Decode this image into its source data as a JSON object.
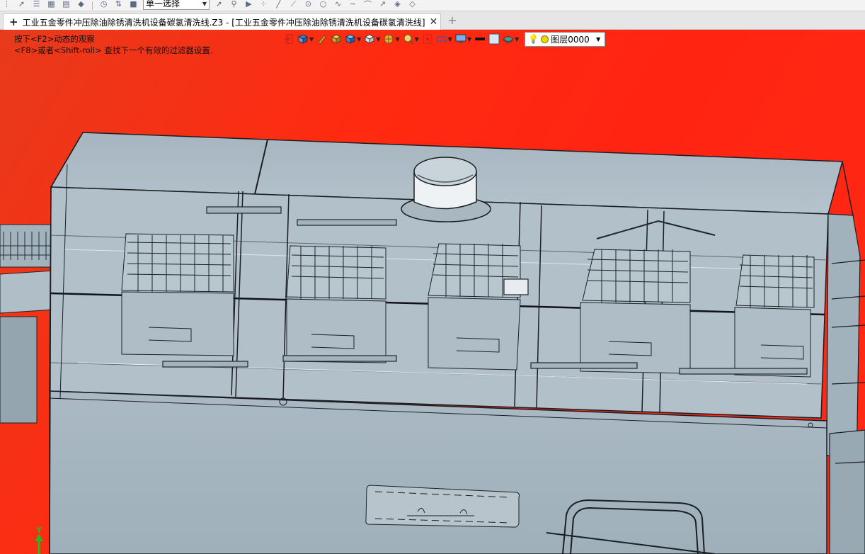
{
  "toolbar": {
    "selection_mode": "单一选择"
  },
  "tab": {
    "title": "工业五金零件冲压除油除锈清洗机设备碳氢清洗线.Z3 - [工业五金零件冲压除油除锈清洗机设备碳氢清洗线]",
    "close_glyph": "✕",
    "new_tab_glyph": "+"
  },
  "viewport": {
    "hint_line1": "按下<F2>动态的观察",
    "hint_line2": "<F8>或者<Shift-roll> 查找下一个有效的过滤器设置.",
    "layer_name": "图层0000",
    "triad_label": "Y"
  },
  "colors": {
    "background_top": "#ff2a10",
    "model_body": "#a9bac4",
    "model_edge": "#1a1f24"
  }
}
